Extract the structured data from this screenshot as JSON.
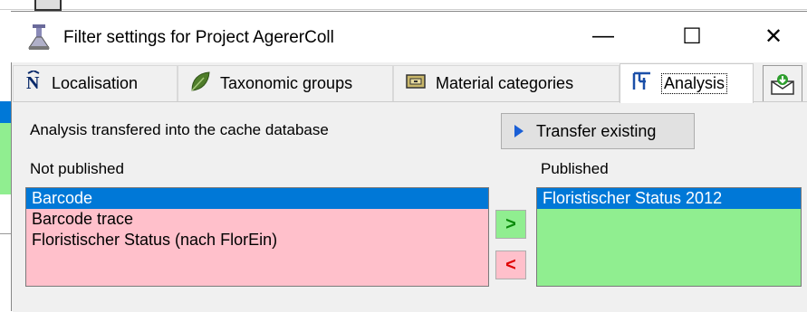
{
  "window": {
    "title": "Filter settings for Project AgererColl",
    "minimize_glyph": "—",
    "maximize_glyph": "☐",
    "close_glyph": "✕"
  },
  "tabs": [
    {
      "label": "Localisation",
      "icon": "localisation-n-icon"
    },
    {
      "label": "Taxonomic groups",
      "icon": "leaf-icon"
    },
    {
      "label": "Material categories",
      "icon": "drawer-icon"
    },
    {
      "label": "Analysis",
      "icon": "analysis-icon",
      "selected": true
    }
  ],
  "email_button_icon": "email-envelope-icon",
  "analysis": {
    "info_text": "Analysis transfered into the cache database",
    "transfer_button": "Transfer existing",
    "not_published_label": "Not published",
    "published_label": "Published",
    "not_published_items": [
      "Barcode",
      "Barcode trace",
      "Floristischer Status (nach FlorEin)"
    ],
    "published_items": [
      "Floristischer Status 2012"
    ],
    "add_button": ">",
    "remove_button": "<"
  },
  "colors": {
    "not_published_bg": "#ffc0cb",
    "published_bg": "#90ee90",
    "selection": "#0078d7"
  }
}
